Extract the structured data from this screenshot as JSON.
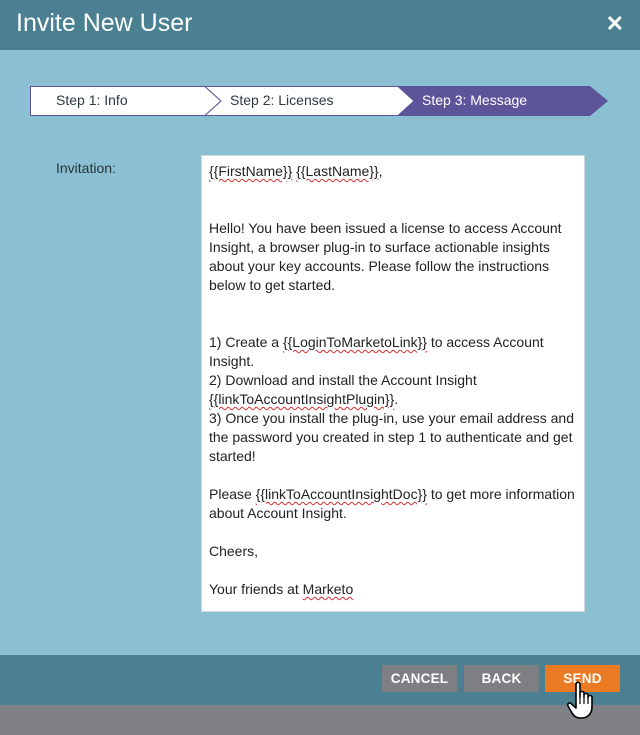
{
  "dialog": {
    "title": "Invite New User",
    "close_icon": "close-icon",
    "steps": [
      {
        "label": "Step 1: Info",
        "state": "inactive"
      },
      {
        "label": "Step 2: Licenses",
        "state": "inactive"
      },
      {
        "label": "Step 3: Message",
        "state": "active"
      }
    ],
    "invitation_label": "Invitation:",
    "message": {
      "greeting_first": "{{FirstName}}",
      "greeting_last": "{{LastName}}",
      "greeting_suffix": ",",
      "intro": "Hello! You have been issued a license to access Account Insight, a browser plug-in to surface actionable insights about your key accounts. Please follow the instructions below to get started.",
      "step1_a": "1) Create a ",
      "step1_token": "{{LoginToMarketoLink}}",
      "step1_b": " to access Account Insight.",
      "step2_a": "2) Download and install the Account Insight ",
      "step2_token": "{{linkToAccountInsightPlugin}}",
      "step2_b": ".",
      "step3": "3) Once you install the plug-in, use your email address and the password you created in step 1 to authenticate and get started!",
      "please_a": "Please ",
      "please_token": "{{linkToAccountInsightDoc}}",
      "please_b": " to get more information about Account Insight.",
      "cheers": "Cheers,",
      "sign_a": "Your friends at ",
      "sign_b": "Marketo"
    },
    "buttons": {
      "cancel": "CANCEL",
      "back": "BACK",
      "send": "SEND"
    },
    "colors": {
      "header": "#4a8091",
      "body": "#8ac0d2",
      "step_active": "#5c559a",
      "send": "#ea7b23",
      "secondary_button": "#7d7f82"
    }
  }
}
